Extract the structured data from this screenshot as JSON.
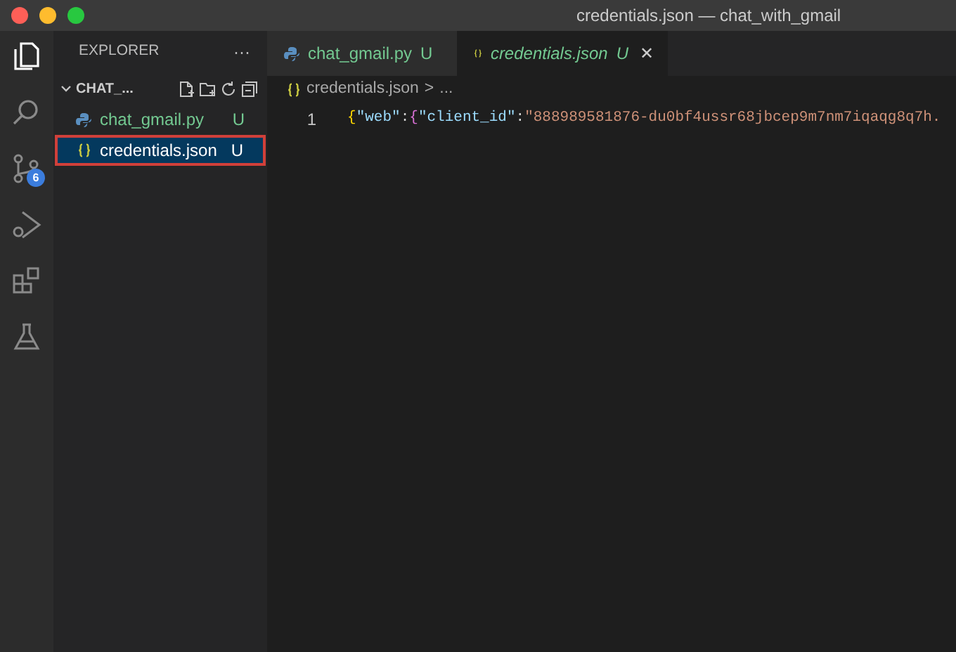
{
  "window": {
    "title": "credentials.json — chat_with_gmail"
  },
  "activity_bar": [
    {
      "kind": "files",
      "selected": true
    },
    {
      "kind": "search",
      "selected": false
    },
    {
      "kind": "scm",
      "selected": false,
      "badge": "6"
    },
    {
      "kind": "debug",
      "selected": false
    },
    {
      "kind": "extensions",
      "selected": false
    },
    {
      "kind": "testing",
      "selected": false
    }
  ],
  "explorer": {
    "title": "EXPLORER",
    "more": "···",
    "folder": "CHAT_...",
    "expanded": true,
    "files": [
      {
        "kind": "python",
        "name": "chat_gmail.py",
        "status": "U",
        "selected": false,
        "outlined": false
      },
      {
        "kind": "json",
        "name": "credentials.json",
        "status": "U",
        "selected": true,
        "outlined": true
      }
    ]
  },
  "tabs": [
    {
      "kind": "python",
      "label": "chat_gmail.py",
      "status": "U",
      "selected": false,
      "preview": false
    },
    {
      "kind": "json",
      "label": "credentials.json",
      "status": "U",
      "selected": true,
      "preview": true,
      "close": "✕"
    }
  ],
  "breadcrumb": {
    "file": "credentials.json",
    "separator": ">",
    "rest": "..."
  },
  "editor": {
    "lines": [
      {
        "number": "1",
        "tokens": [
          {
            "kind": "brace",
            "text": "{"
          },
          {
            "kind": "key",
            "text": "\"web\""
          },
          {
            "kind": "punct",
            "text": ":"
          },
          {
            "kind": "brace2",
            "text": "{"
          },
          {
            "kind": "key",
            "text": "\"client_id\""
          },
          {
            "kind": "punct",
            "text": ":"
          },
          {
            "kind": "string",
            "text": "\"888989581876-du0bf4ussr68jbcep9m7nm7iqaqg8q7h."
          }
        ]
      }
    ]
  }
}
